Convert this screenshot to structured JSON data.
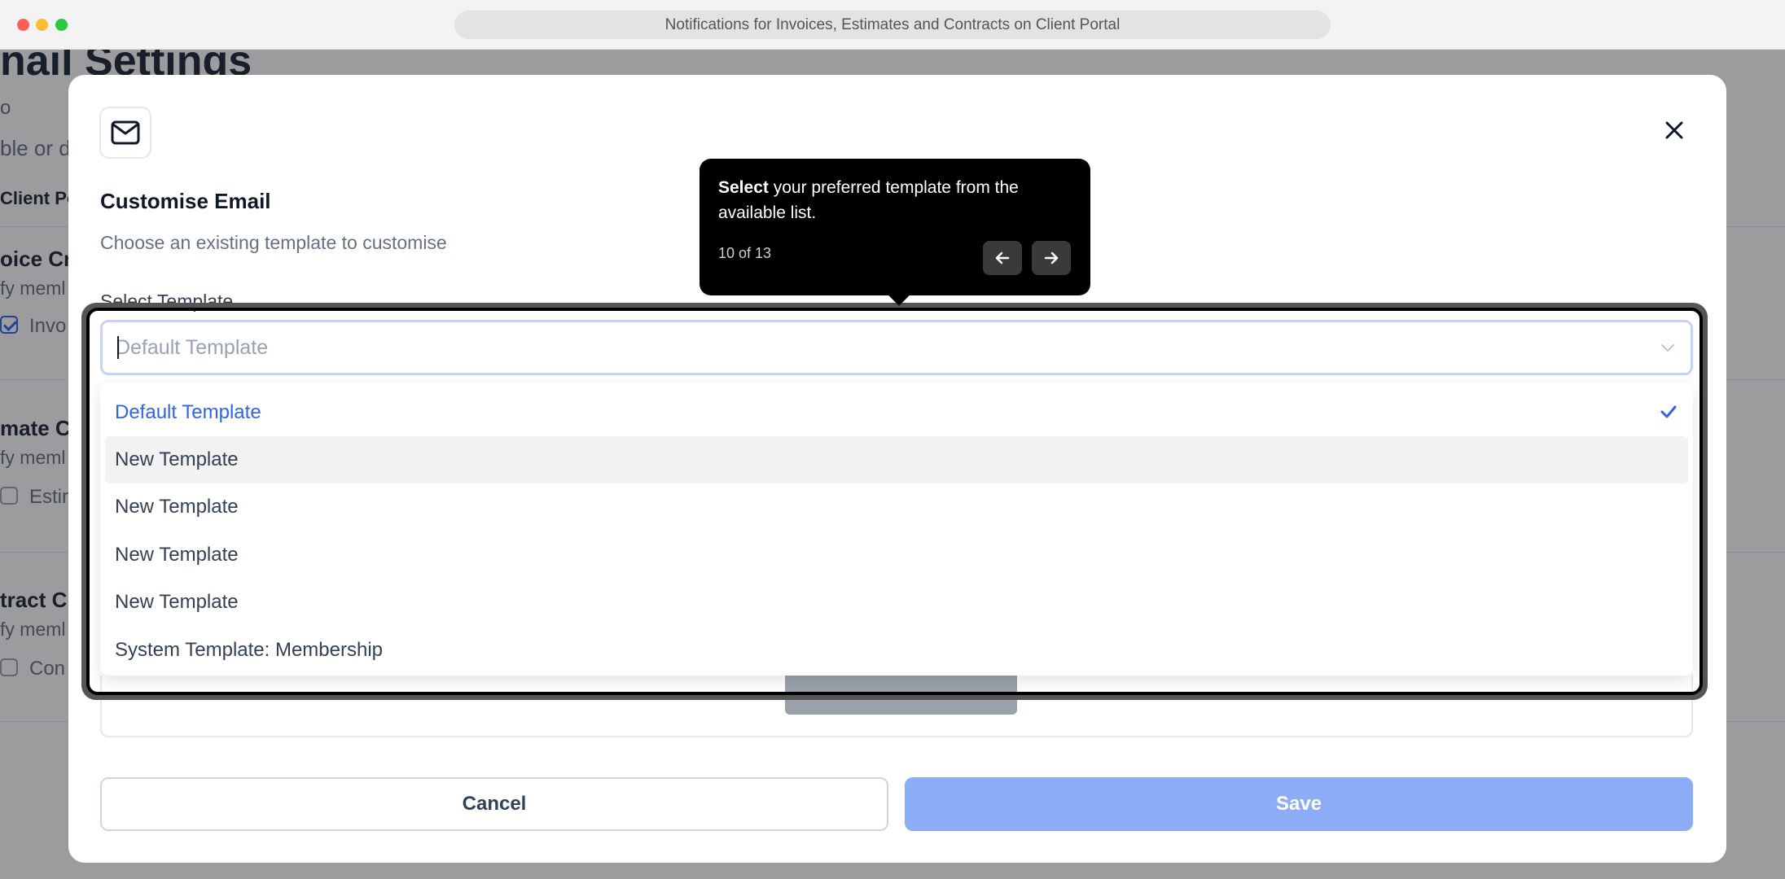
{
  "window": {
    "url_title": "Notifications for Invoices, Estimates and Contracts on Client Portal"
  },
  "background_page": {
    "heading": "nail Settings",
    "fragment_1": "o",
    "fragment_2": "ble or d",
    "fragment_3": "Client Po",
    "section_1_title": "oice Cre",
    "section_1_sub": "fy meml",
    "section_1_check": "Invo",
    "section_2_title": "mate C",
    "section_2_sub": "fy meml",
    "section_2_check": "Estir",
    "section_3_title": "tract C",
    "section_3_sub": "fy meml",
    "section_3_check": "Con"
  },
  "modal": {
    "icon": "mail-icon",
    "title": "Customise Email",
    "subtitle": "Choose an existing template to customise",
    "select_label": "Select Template",
    "select_placeholder": "Default Template",
    "options": [
      {
        "label": "Default Template",
        "selected": true
      },
      {
        "label": "New Template",
        "selected": false
      },
      {
        "label": "New Template",
        "selected": false
      },
      {
        "label": "New Template",
        "selected": false
      },
      {
        "label": "New Template",
        "selected": false
      },
      {
        "label": "System Template: Membership",
        "selected": false
      }
    ],
    "cancel_label": "Cancel",
    "save_label": "Save"
  },
  "tooltip": {
    "bold": "Select",
    "text": " your preferred template from the available list.",
    "step_counter": "10 of 13",
    "prev_icon": "arrow-left-icon",
    "next_icon": "arrow-right-icon"
  },
  "colors": {
    "accent": "#2f64e8",
    "save_disabled": "#8cacf5",
    "tooltip_bg": "#000000"
  }
}
